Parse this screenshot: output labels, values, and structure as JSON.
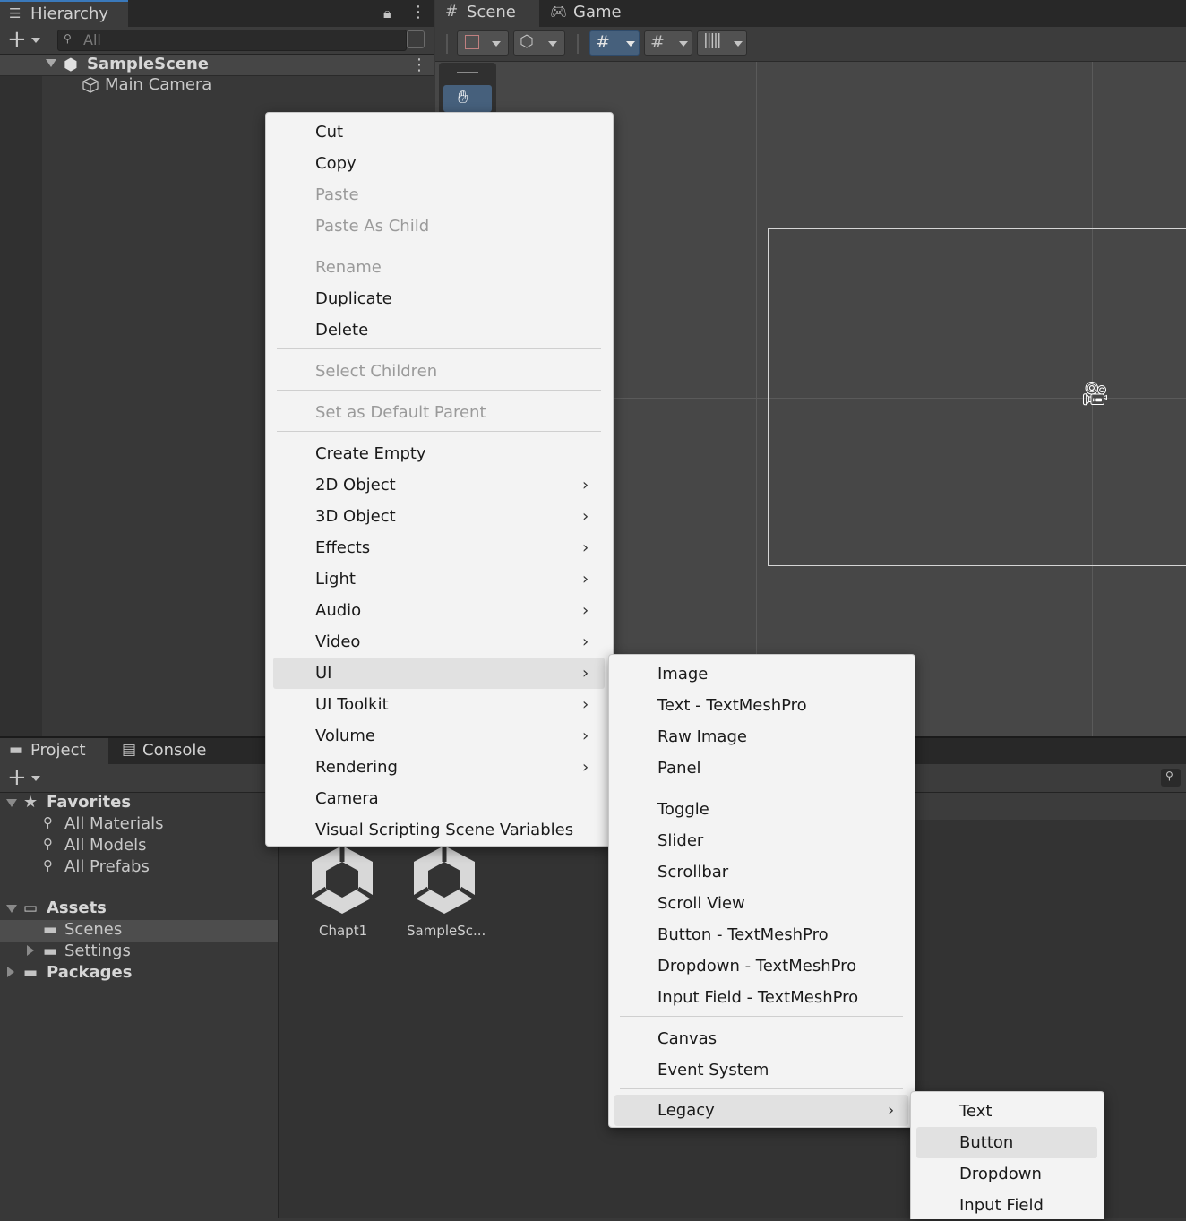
{
  "hierarchy": {
    "tab_label": "Hierarchy",
    "search_placeholder": "All",
    "scene_name": "SampleScene",
    "objects": [
      "Main Camera"
    ]
  },
  "scene_tabs": {
    "scene_label": "Scene",
    "game_label": "Game"
  },
  "project": {
    "project_tab": "Project",
    "console_tab": "Console",
    "tree": {
      "favorites": "Favorites",
      "favorites_items": [
        "All Materials",
        "All Models",
        "All Prefabs"
      ],
      "assets": "Assets",
      "assets_children": [
        "Scenes",
        "Settings"
      ],
      "packages": "Packages"
    },
    "files": [
      "Chapt1",
      "SampleSc..."
    ]
  },
  "context_menu": {
    "items": [
      "Cut",
      "Copy",
      "Paste",
      "Paste As Child",
      "Rename",
      "Duplicate",
      "Delete",
      "Select Children",
      "Set as Default Parent",
      "Create Empty",
      "2D Object",
      "3D Object",
      "Effects",
      "Light",
      "Audio",
      "Video",
      "UI",
      "UI Toolkit",
      "Volume",
      "Rendering",
      "Camera",
      "Visual Scripting Scene Variables"
    ],
    "disabled": [
      "Paste",
      "Paste As Child",
      "Rename",
      "Select Children",
      "Set as Default Parent"
    ],
    "highlighted": "UI"
  },
  "ui_submenu": {
    "items": [
      "Image",
      "Text - TextMeshPro",
      "Raw Image",
      "Panel",
      "Toggle",
      "Slider",
      "Scrollbar",
      "Scroll View",
      "Button - TextMeshPro",
      "Dropdown - TextMeshPro",
      "Input Field - TextMeshPro",
      "Canvas",
      "Event System",
      "Legacy"
    ],
    "highlighted": "Legacy"
  },
  "legacy_submenu": {
    "items": [
      "Text",
      "Button",
      "Dropdown",
      "Input Field"
    ],
    "highlighted": "Button"
  },
  "colors": {
    "editor_bg": "#383838",
    "menu_bg": "#f3f3f3",
    "menu_highlight": "#e1e1e1",
    "active_tab_accent": "#3a79bb",
    "tool_active": "#46607c"
  }
}
